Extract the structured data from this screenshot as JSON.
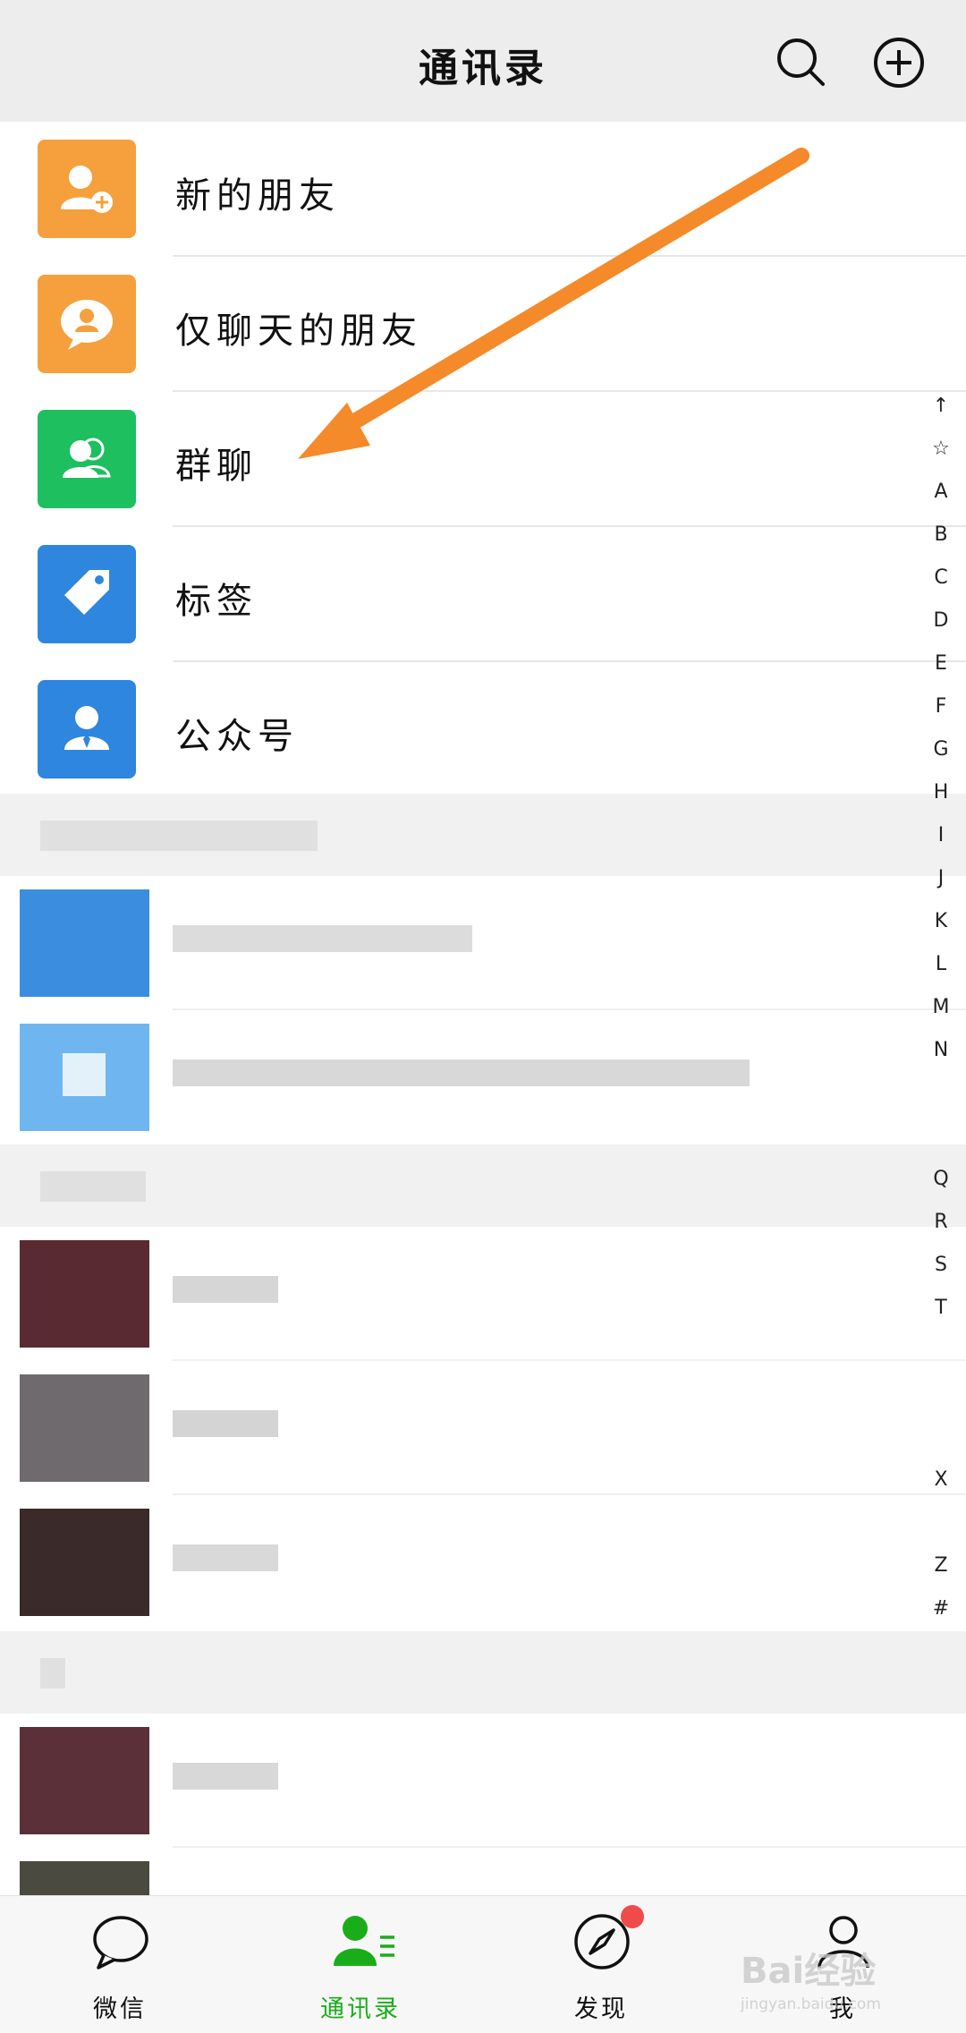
{
  "header": {
    "title": "通讯录",
    "search_icon": "search-icon",
    "add_icon": "plus-circle-icon"
  },
  "menu": [
    {
      "label": "新的朋友",
      "icon": "add-friend-icon",
      "color": "#f5a03c"
    },
    {
      "label": "仅聊天的朋友",
      "icon": "chat-only-friend-icon",
      "color": "#f5a03c"
    },
    {
      "label": "群聊",
      "icon": "group-chat-icon",
      "color": "#1dbf5e"
    },
    {
      "label": "标签",
      "icon": "tag-icon",
      "color": "#2e86de"
    },
    {
      "label": "公众号",
      "icon": "official-account-icon",
      "color": "#2e86de"
    }
  ],
  "index_bar": [
    "↑",
    "☆",
    "A",
    "B",
    "C",
    "D",
    "E",
    "F",
    "G",
    "H",
    "I",
    "J",
    "K",
    "L",
    "M",
    "N",
    "",
    "",
    "Q",
    "R",
    "S",
    "T",
    "",
    "",
    "",
    "X",
    "",
    "Z",
    "#"
  ],
  "tabs": [
    {
      "label": "微信",
      "icon": "chat-bubble-icon",
      "active": false
    },
    {
      "label": "通讯录",
      "icon": "contacts-icon",
      "active": true
    },
    {
      "label": "发现",
      "icon": "compass-icon",
      "active": false,
      "badge": true
    },
    {
      "label": "我",
      "icon": "person-icon",
      "active": false
    }
  ],
  "watermark": {
    "main": "Bai经验",
    "sub": "jingyan.baidu.com"
  },
  "colors": {
    "accent": "#1aad19",
    "arrow": "#f58a2a"
  }
}
